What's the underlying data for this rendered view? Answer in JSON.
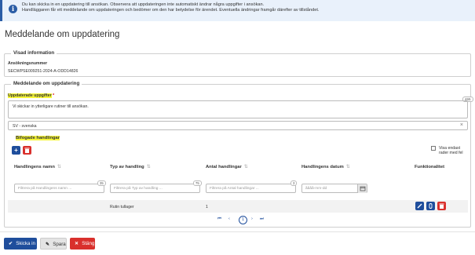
{
  "info": {
    "icon": "info-icon",
    "lines": [
      "Du kan skicka in en uppdatering till ansökan. Observera att uppdateringen inte automatiskt ändrar några uppgifter i ansökan.",
      "Handläggaren får ett meddelande om uppdateringen och bedömer om den har betydelse för ärendet. Eventuella ändringar framgår därefter av tillståndet."
    ]
  },
  "page_title": "Meddelande om uppdatering",
  "visad_information": {
    "legend": "Visad information",
    "label": "Ansökningsnummer",
    "value": "SECWPSE009251-2024-A-ODD14826"
  },
  "meddelande": {
    "legend": "Meddelande om uppdatering",
    "updated_label": "Uppdaterade uppgifter",
    "required_mark": "*",
    "text_value": "Vi skickar in ytterligare rutiner till ansökan.",
    "char_counter": "465",
    "language_value": "SV - svenska",
    "clear_icon": "close-icon"
  },
  "attachments": {
    "title": "Bifogade handlingar",
    "add_icon": "plus-icon",
    "delete_icon": "trash-icon",
    "only_rows_label": "Visa endast rader med fel",
    "columns": [
      {
        "label": "Handlingens namn",
        "sort_icon": "sort-icon"
      },
      {
        "label": "Typ av handling",
        "sort_icon": "sort-icon"
      },
      {
        "label": "Antal handlingar",
        "sort_icon": "sort-icon"
      },
      {
        "label": "Handlingens datum",
        "sort_icon": "sort-icon"
      },
      {
        "label": "Funktionalitet"
      }
    ],
    "filters": [
      {
        "placeholder": "Filtrera på Handlingens namn ...",
        "count": "35"
      },
      {
        "placeholder": "Filtrera på Typ av handling ...",
        "count": "75"
      },
      {
        "placeholder": "Filtrera på Antal handlingar ...",
        "count": "3"
      },
      {
        "placeholder": "åååå-mm-dd",
        "icon": "calendar-icon"
      }
    ],
    "rows": [
      {
        "name": "",
        "type": "Rutin tullager",
        "count": "1",
        "date": ""
      }
    ],
    "row_actions": [
      "edit-icon",
      "paperclip-icon",
      "trash-icon"
    ],
    "pagination": {
      "first": "⏮",
      "prev": "‹",
      "current": "1",
      "next": "›",
      "last": "⏭"
    }
  },
  "buttons": {
    "submit": "Skicka in",
    "save": "Spara",
    "close": "Stäng"
  },
  "colors": {
    "primary": "#1f4e9c",
    "danger": "#d9302c",
    "info_bg": "#e9f1fb",
    "highlight": "#f6f63a"
  }
}
